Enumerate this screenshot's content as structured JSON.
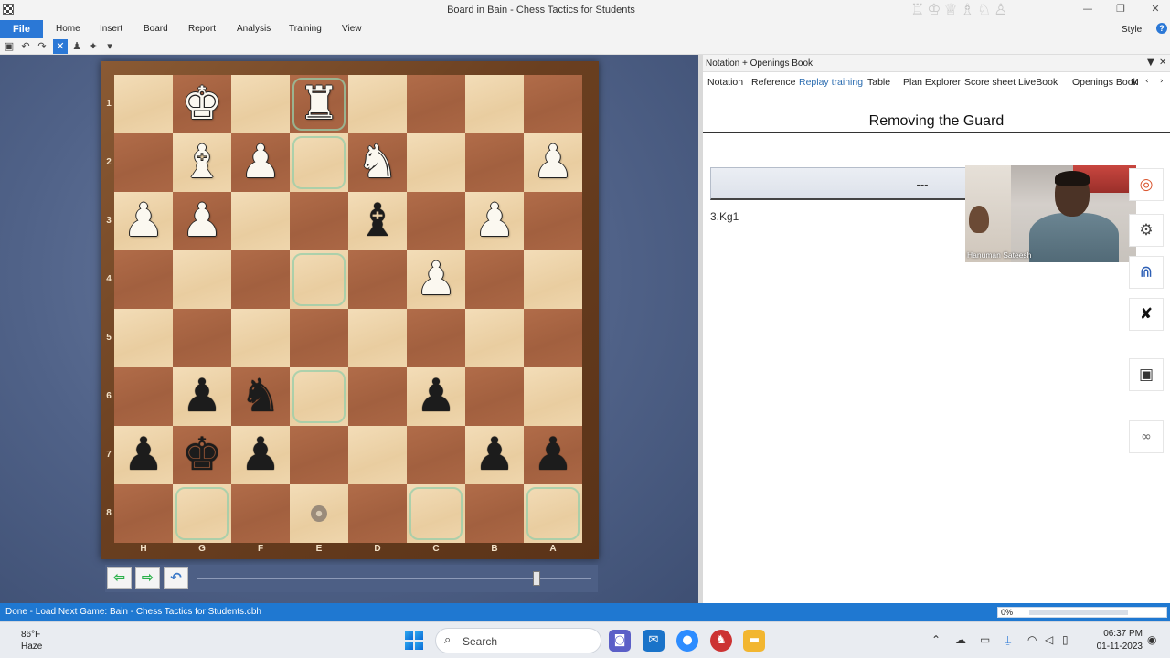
{
  "window": {
    "title": "Board in Bain - Chess Tactics for Students",
    "title_pieces": [
      "♖",
      "♔",
      "♕",
      "♗",
      "♘",
      "♙"
    ]
  },
  "ribbon": {
    "file": "File",
    "tabs": [
      "Home",
      "Insert",
      "Board",
      "Report",
      "Analysis",
      "Training",
      "View"
    ],
    "style": "Style",
    "help": "?"
  },
  "board": {
    "ranks": [
      "1",
      "2",
      "3",
      "4",
      "5",
      "6",
      "7",
      "8"
    ],
    "files": [
      "H",
      "G",
      "F",
      "E",
      "D",
      "C",
      "B",
      "A"
    ],
    "squares": [
      [
        "",
        "wK",
        "",
        "wR",
        "",
        "",
        "",
        ""
      ],
      [
        "",
        "wB",
        "wP",
        "",
        "wN",
        "",
        "",
        "wP"
      ],
      [
        "wP",
        "wP",
        "",
        "",
        "bB",
        "",
        "wP",
        ""
      ],
      [
        "",
        "",
        "",
        "",
        "",
        "wP",
        "",
        ""
      ],
      [
        "",
        "",
        "",
        "",
        "",
        "",
        "",
        ""
      ],
      [
        "",
        "bP",
        "bN",
        "",
        "",
        "bP",
        "",
        ""
      ],
      [
        "bP",
        "bK",
        "bP",
        "",
        "",
        "",
        "bP",
        "bP"
      ],
      [
        "",
        "",
        "",
        "",
        "",
        "",
        "",
        ""
      ]
    ],
    "highlights": [
      [
        0,
        3
      ],
      [
        1,
        3
      ],
      [
        3,
        3
      ],
      [
        5,
        3
      ],
      [
        7,
        1
      ],
      [
        7,
        5
      ],
      [
        7,
        7
      ]
    ],
    "marker": [
      7,
      3
    ],
    "glyphs": {
      "K": "♚",
      "Q": "♛",
      "R": "♜",
      "B": "♝",
      "N": "♞",
      "P": "♟"
    }
  },
  "nav": {
    "back": "⇦",
    "forward": "⇨",
    "undo": "↶",
    "slider_fraction": 0.86
  },
  "pane": {
    "header": "Notation + Openings Book",
    "tabs": [
      "Notation",
      "Reference",
      "Replay training",
      "Table",
      "Plan Explorer",
      "Score sheet",
      "LiveBook",
      "Openings Book",
      "M"
    ],
    "active_tab": "Replay training",
    "heading": "Removing the Guard",
    "answer": "---",
    "move": "3.Kg1",
    "video_name": "Hanuman Sateesh"
  },
  "status": {
    "text": "Done - Load Next Game: Bain - Chess Tactics for Students.cbh",
    "progress": "0%"
  },
  "taskbar": {
    "temp": "86°F",
    "weather": "Haze",
    "search": "Search",
    "time": "06:37 PM",
    "date": "01-11-2023"
  }
}
